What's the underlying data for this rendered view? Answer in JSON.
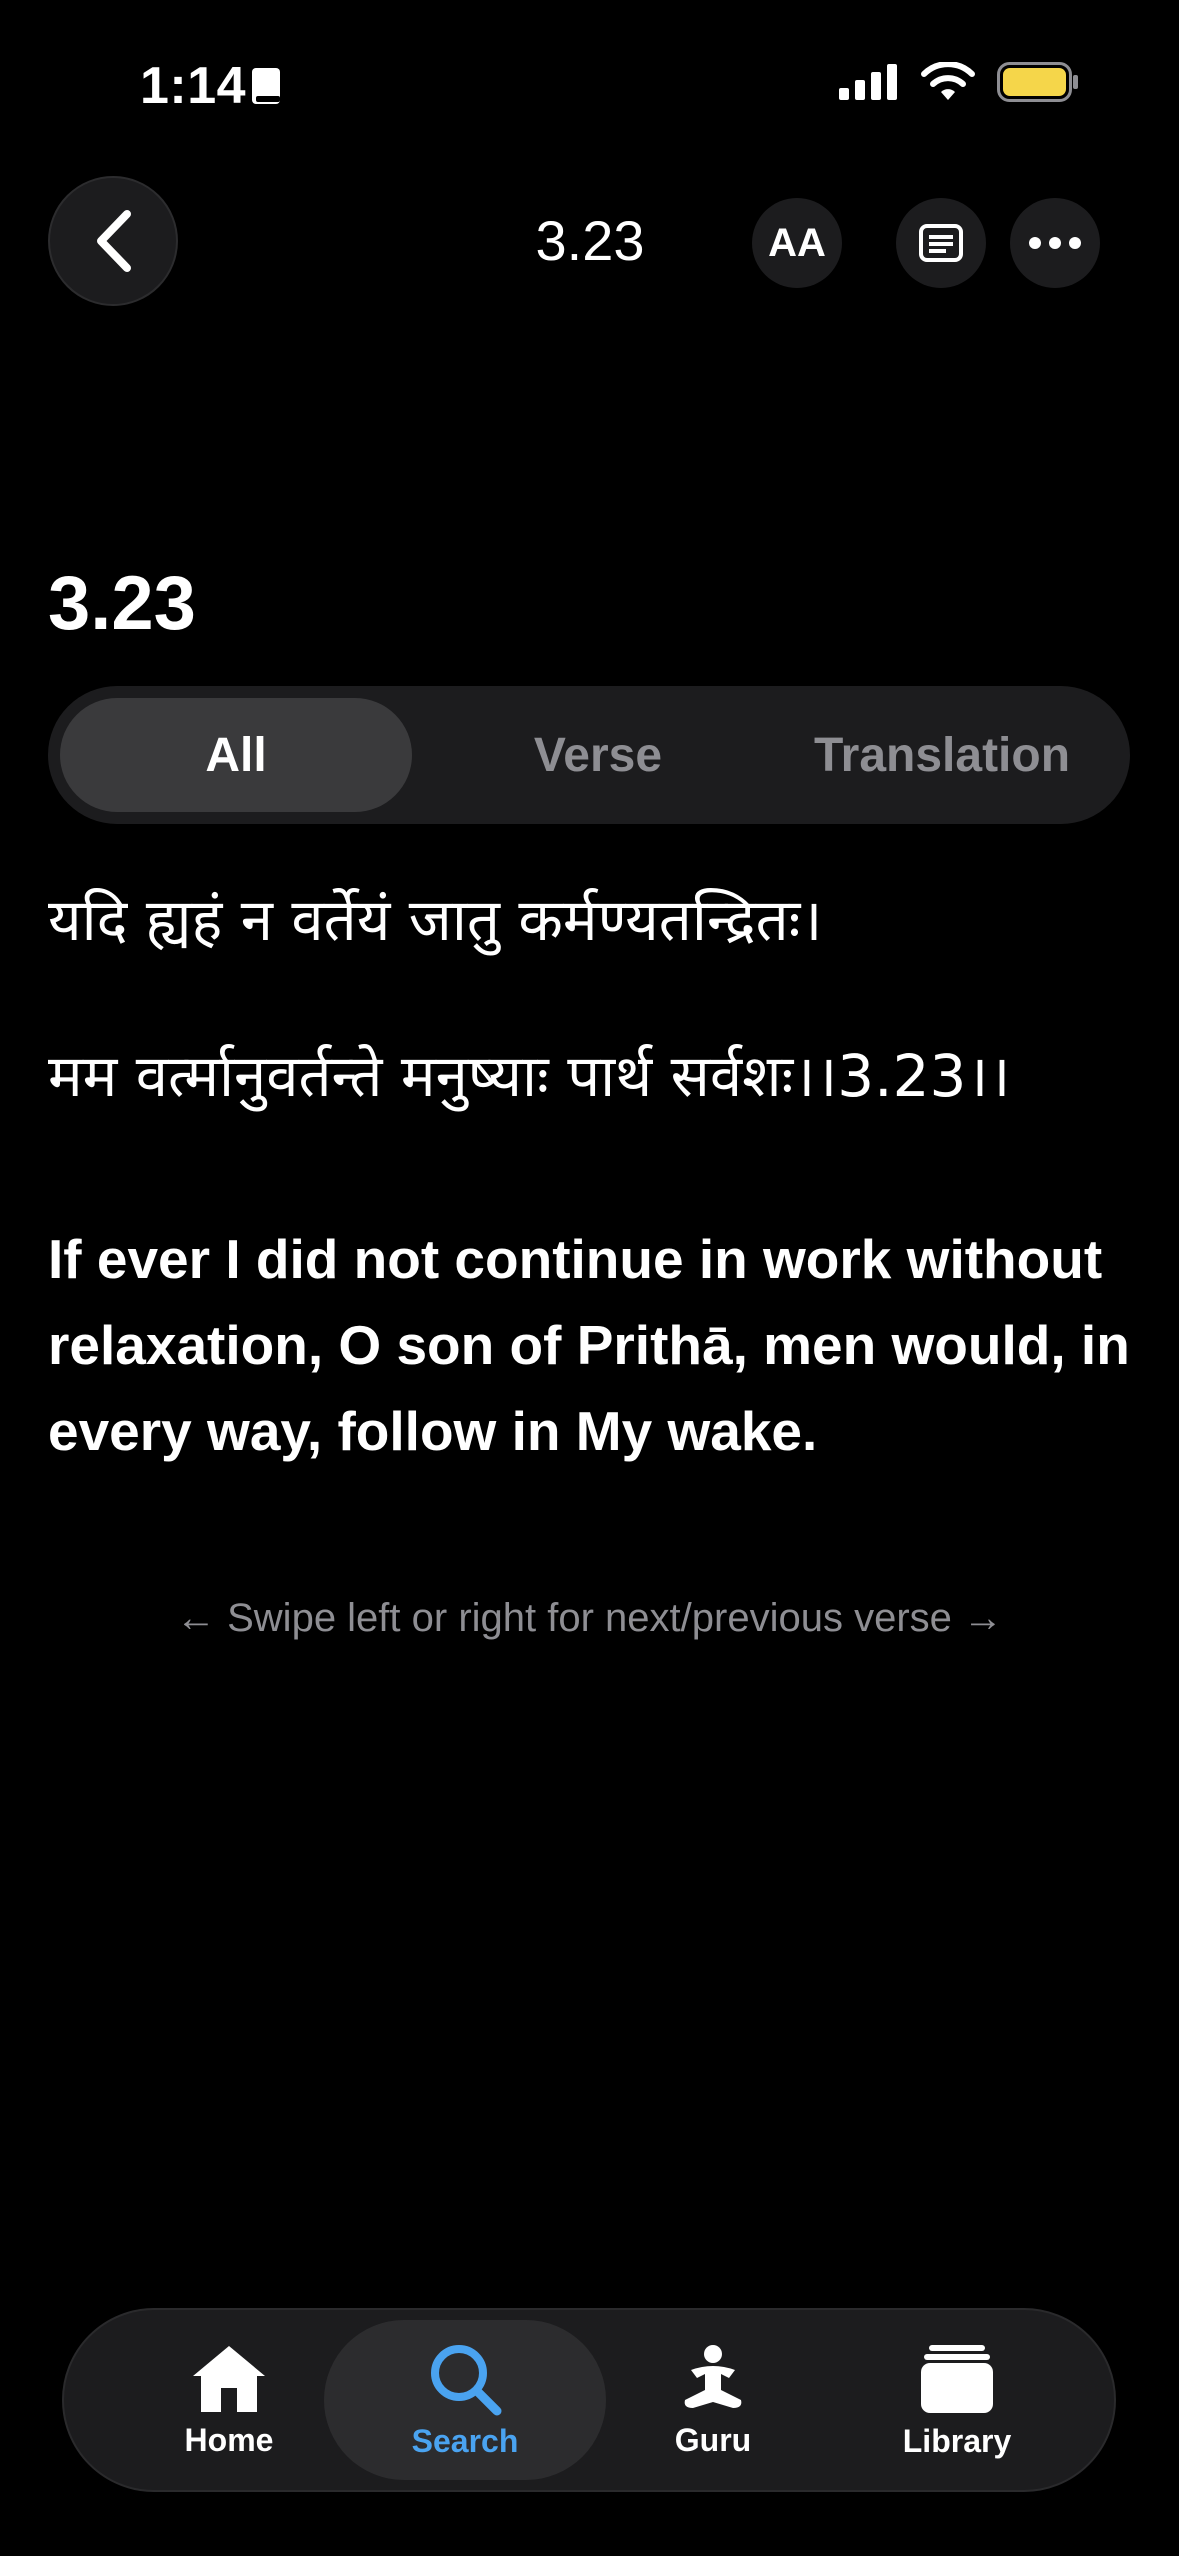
{
  "status": {
    "time": "1:14"
  },
  "nav": {
    "title": "3.23",
    "font_button_label": "AA"
  },
  "heading": "3.23",
  "segments": [
    "All",
    "Verse",
    "Translation"
  ],
  "verse": {
    "line1": "यदि ह्यहं न वर्तेयं जातु कर्मण्यतन्द्रितः।",
    "line2": "मम वर्त्मानुवर्तन्ते मनुष्याः पार्थ सर्वशः।।3.23।।"
  },
  "translation": "If ever I did not continue in work without relaxation, O son of Prithā, men would, in every way, follow in My wake.",
  "swipe_hint": "← Swipe left or right for next/previous verse →",
  "tabs": [
    {
      "label": "Home",
      "icon": "home-icon"
    },
    {
      "label": "Search",
      "icon": "search-icon",
      "active": true
    },
    {
      "label": "Guru",
      "icon": "guru-icon"
    },
    {
      "label": "Library",
      "icon": "library-icon"
    }
  ],
  "colors": {
    "accent": "#4aa3f0",
    "battery": "#f5d64a"
  }
}
